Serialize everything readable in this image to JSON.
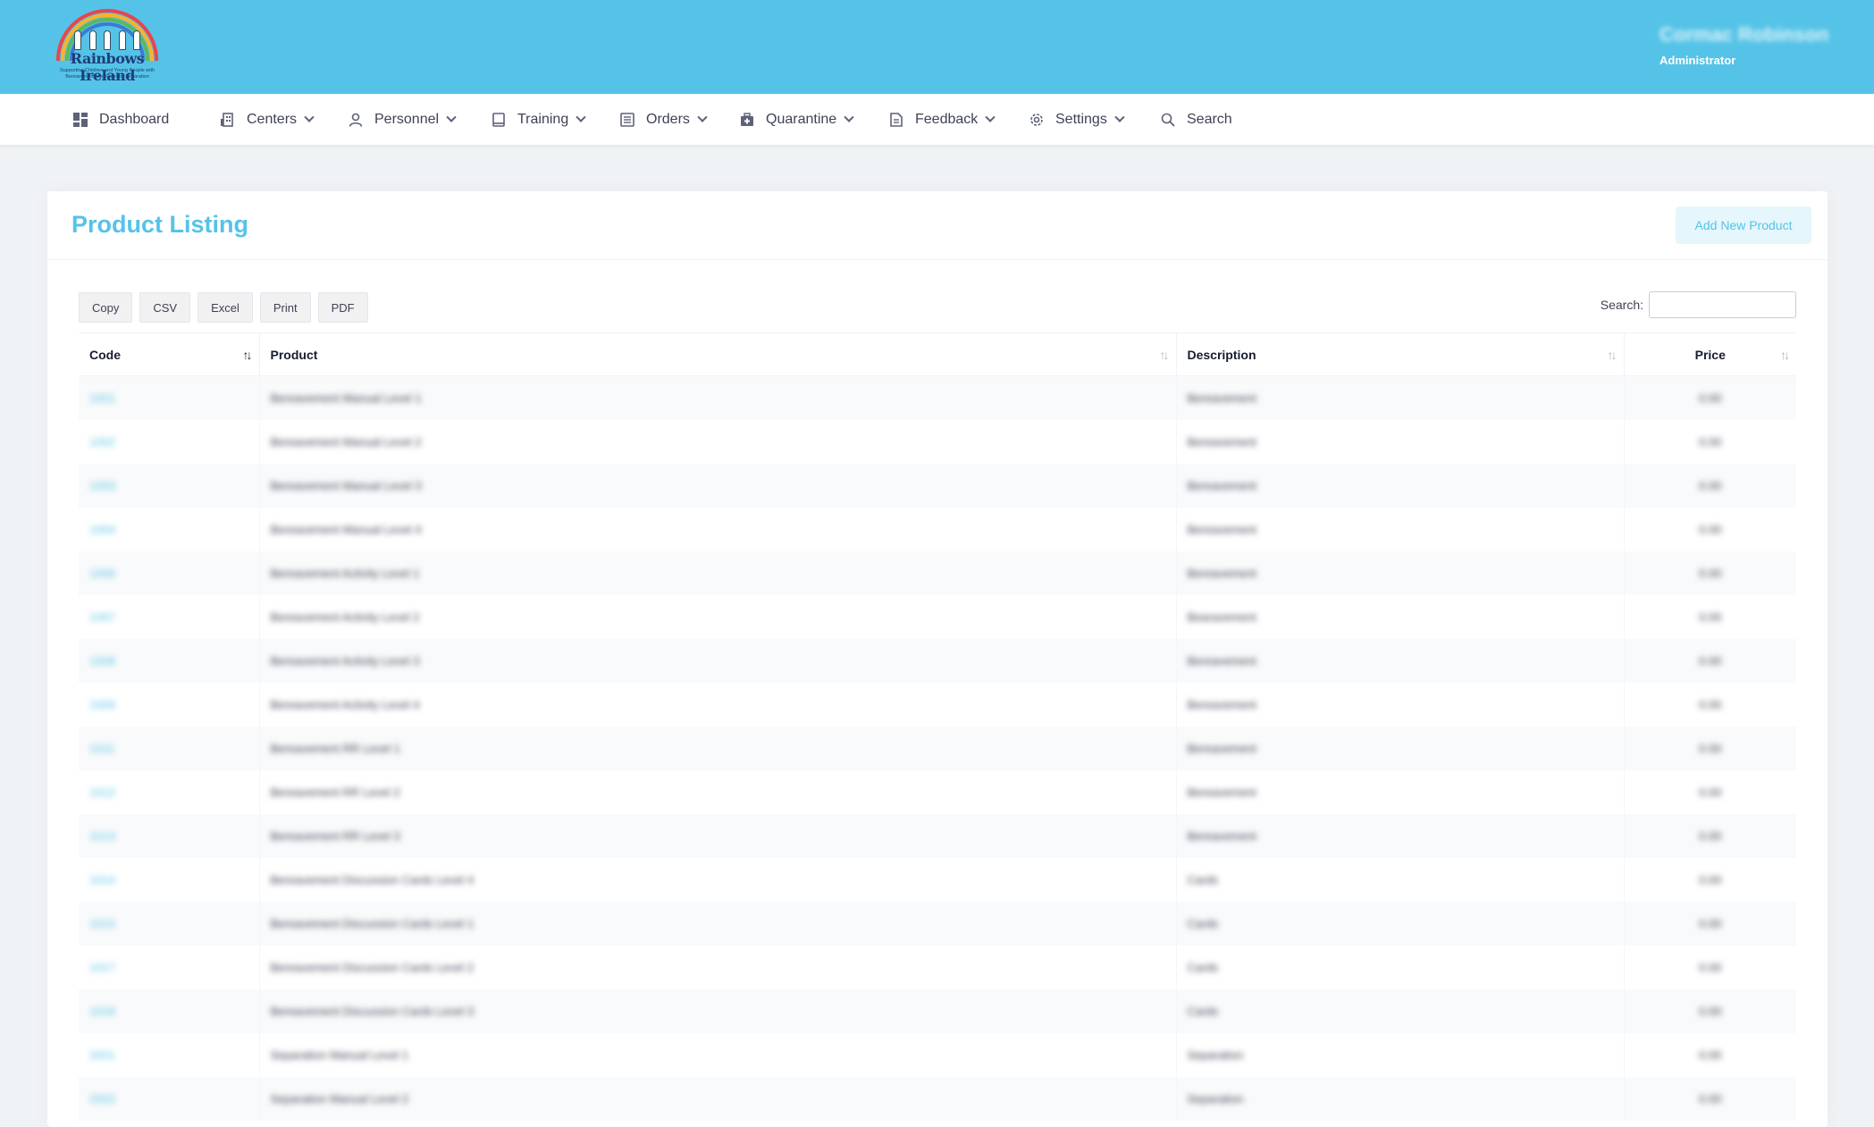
{
  "header": {
    "brand": "Rainbows Ireland",
    "tagline": "Supporting Children and Young People with Bereavement and Parental Separation",
    "user_name": "Cormac Robinson",
    "user_role": "Administrator"
  },
  "nav": [
    {
      "label": "Dashboard",
      "icon": "dashboard-icon"
    },
    {
      "label": "Centers",
      "icon": "building-icon"
    },
    {
      "label": "Personnel",
      "icon": "user-icon"
    },
    {
      "label": "Training",
      "icon": "book-icon"
    },
    {
      "label": "Orders",
      "icon": "list-icon"
    },
    {
      "label": "Quarantine",
      "icon": "medkit-icon"
    },
    {
      "label": "Feedback",
      "icon": "document-icon"
    },
    {
      "label": "Settings",
      "icon": "gear-icon"
    },
    {
      "label": "Search",
      "icon": "search-icon"
    }
  ],
  "page": {
    "title": "Product Listing",
    "add_button": "Add New Product"
  },
  "export_buttons": [
    "Copy",
    "CSV",
    "Excel",
    "Print",
    "PDF"
  ],
  "search": {
    "label": "Search:",
    "value": ""
  },
  "table": {
    "columns": [
      "Code",
      "Product",
      "Description",
      "Price"
    ],
    "rows": [
      {
        "code": "1001",
        "product": "Bereavement Manual Level 1",
        "description": "Bereavement",
        "price": "0.00"
      },
      {
        "code": "1002",
        "product": "Bereavement Manual Level 2",
        "description": "Bereavement",
        "price": "0.00"
      },
      {
        "code": "1003",
        "product": "Bereavement Manual Level 3",
        "description": "Bereavement",
        "price": "0.00"
      },
      {
        "code": "1004",
        "product": "Bereavement Manual Level 4",
        "description": "Bereavement",
        "price": "0.00"
      },
      {
        "code": "1006",
        "product": "Bereavement Activity Level 1",
        "description": "Bereavement",
        "price": "0.00"
      },
      {
        "code": "1007",
        "product": "Bereavement Activity Level 2",
        "description": "Bearavement",
        "price": "0.00"
      },
      {
        "code": "1008",
        "product": "Bereavement Activity Level 3",
        "description": "Bereavement",
        "price": "0.00"
      },
      {
        "code": "1009",
        "product": "Bereavement Activity Level 4",
        "description": "Bereavement",
        "price": "0.00"
      },
      {
        "code": "1011",
        "product": "Bereavement RR Level 1",
        "description": "Bereavement",
        "price": "0.00"
      },
      {
        "code": "1012",
        "product": "Bereavement RR Level 2",
        "description": "Bereavement",
        "price": "0.00"
      },
      {
        "code": "1013",
        "product": "Bereavement RR Level 3",
        "description": "Bereavement",
        "price": "0.00"
      },
      {
        "code": "1014",
        "product": "Bereavement Discussion Cards Level 4",
        "description": "Cards",
        "price": "0.00"
      },
      {
        "code": "1015",
        "product": "Bereavement Discussion Cards Level 1",
        "description": "Cards",
        "price": "0.00"
      },
      {
        "code": "1017",
        "product": "Bereavement Discussion Cards Level 2",
        "description": "Cards",
        "price": "0.00"
      },
      {
        "code": "1018",
        "product": "Bereavement Discussion Cards Level 3",
        "description": "Cards",
        "price": "0.00"
      },
      {
        "code": "2001",
        "product": "Separation Manual Level 1",
        "description": "Separation",
        "price": "0.00"
      },
      {
        "code": "2002",
        "product": "Separation Manual Level 2",
        "description": "Separation",
        "price": "0.00"
      }
    ]
  }
}
